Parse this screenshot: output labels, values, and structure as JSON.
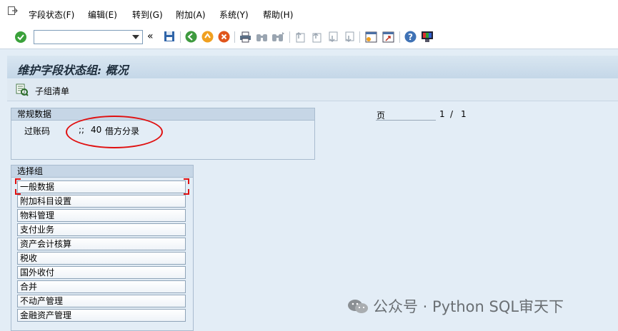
{
  "menu": {
    "items": [
      "字段状态(F)",
      "编辑(E)",
      "转到(G)",
      "附加(A)",
      "系统(Y)",
      "帮助(H)"
    ]
  },
  "toolbar": {
    "command_value": ""
  },
  "screen": {
    "title": "维护字段状态组: 概况",
    "subgroup_list_label": "子组清单"
  },
  "general_data": {
    "header": "常规数据",
    "posting_key_label": "过账码",
    "posting_key_value": ";;",
    "posting_key_code": "40",
    "posting_key_text": "借方分录"
  },
  "paging": {
    "label": "页",
    "current": "1",
    "separator": "/",
    "total": "1"
  },
  "select_group": {
    "header": "选择组",
    "items": [
      "一般数据",
      "附加科目设置",
      "物料管理",
      "支付业务",
      "资产会计核算",
      "税收",
      "国外收付",
      "合并",
      "不动产管理",
      "金融资产管理"
    ]
  },
  "watermark": {
    "text": "公众号 · Python SQL审天下"
  },
  "colors": {
    "highlight": "#e01010",
    "background": "#e3edf6"
  }
}
